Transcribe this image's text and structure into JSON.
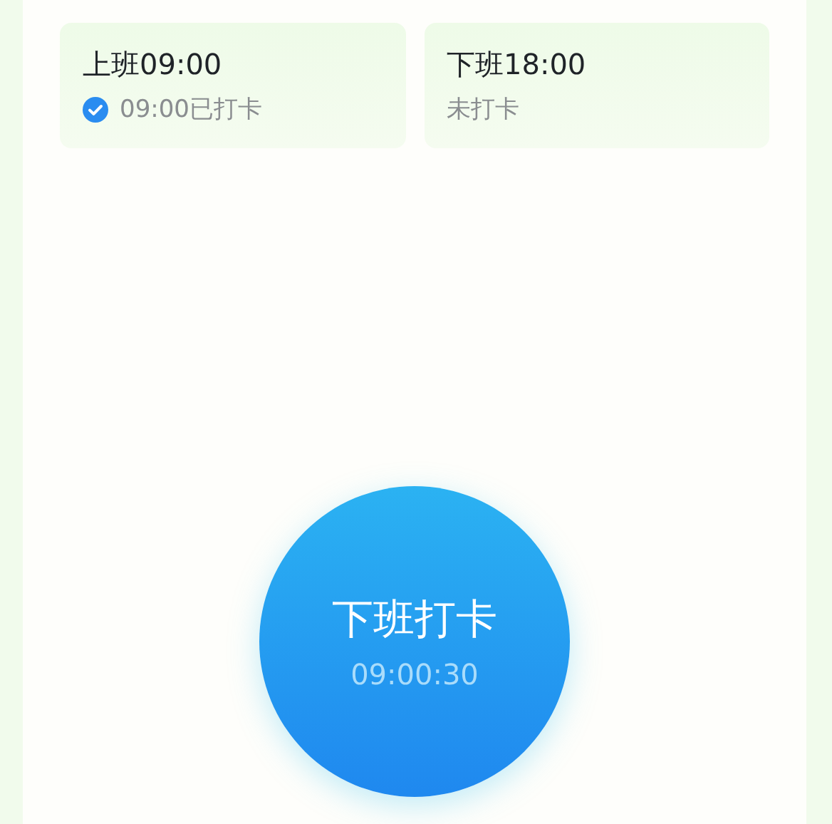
{
  "shifts": [
    {
      "label": "上班09:00",
      "status": "09:00已打卡",
      "checked": true
    },
    {
      "label": "下班18:00",
      "status": "未打卡",
      "checked": false
    }
  ],
  "punch_button": {
    "label": "下班打卡",
    "time": "09:00:30"
  }
}
